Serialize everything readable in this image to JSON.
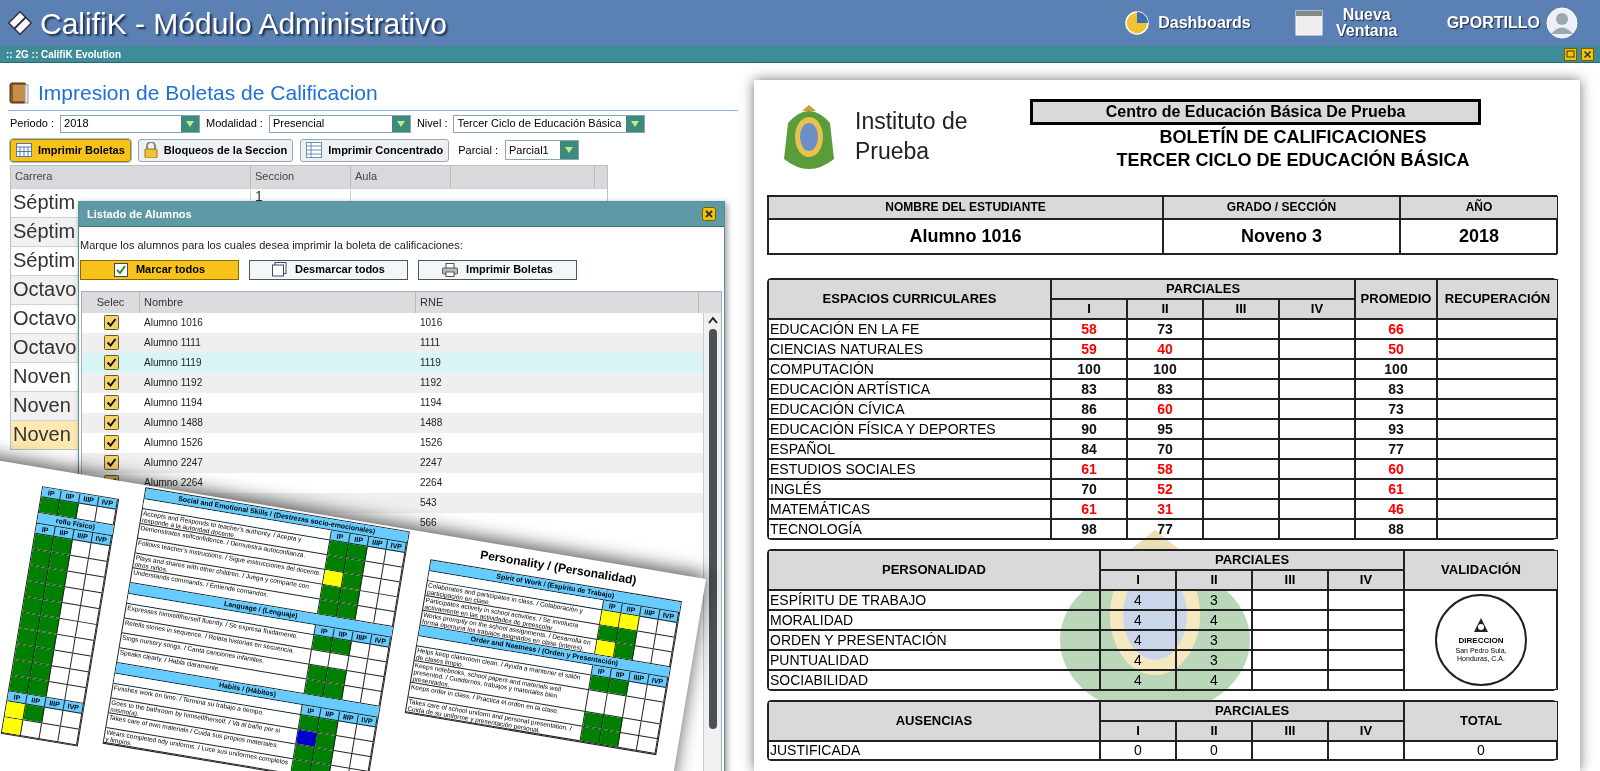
{
  "app_bar": {
    "title": "CalifiK - Módulo Administrativo",
    "links": [
      {
        "kind": "dashboards",
        "label": "Dashboards"
      },
      {
        "kind": "new-window",
        "label": "Nueva Ventana"
      }
    ],
    "user": "GPORTILLO"
  },
  "window_bar": {
    "title": ":: 2G :: CalifiK Evolution"
  },
  "panel": {
    "title": "Impresion de Boletas de Calificacion",
    "filters": [
      {
        "label": "Periodo :",
        "value": "2018"
      },
      {
        "label": "Modalidad :",
        "value": "Presencial"
      },
      {
        "label": "Nivel :",
        "value": "Tercer Ciclo de Educación Básica"
      }
    ],
    "buttons": [
      {
        "kind": "grid",
        "label": "Imprimir Boletas",
        "selected": true
      },
      {
        "kind": "lock",
        "label": "Bloqueos de la Seccion",
        "selected": false
      },
      {
        "kind": "table",
        "label": "Imprimir Concentrado",
        "selected": false
      }
    ],
    "parcial": {
      "label": "Parcial :",
      "value": "Parcial1"
    },
    "grid": {
      "columns": [
        "Carrera",
        "Seccion",
        "Aula"
      ],
      "rows": [
        {
          "carrera": "Séptim",
          "seccion": "1",
          "selected": false
        },
        {
          "carrera": "Séptim",
          "selected": false
        },
        {
          "carrera": "Séptim",
          "selected": false
        },
        {
          "carrera": "Octavo",
          "selected": false
        },
        {
          "carrera": "Octavo",
          "selected": false
        },
        {
          "carrera": "Octavo",
          "selected": false
        },
        {
          "carrera": "Noven",
          "selected": false
        },
        {
          "carrera": "Noven",
          "selected": false
        },
        {
          "carrera": "Noven",
          "selected": true
        }
      ]
    }
  },
  "dialog": {
    "title": "Listado de Alumnos",
    "instruction": "Marque los alumnos para los cuales desea imprimir la boleta de calificaciones:",
    "buttons": [
      {
        "kind": "check-all",
        "label": "Marcar todos",
        "selected": true
      },
      {
        "kind": "uncheck-all",
        "label": "Desmarcar todos",
        "selected": false
      },
      {
        "kind": "print",
        "label": "Imprimir Boletas",
        "selected": false
      }
    ],
    "columns": [
      "Selec",
      "Nombre",
      "RNE"
    ],
    "rows": [
      {
        "name": "Alumno 1016",
        "rne": "1016",
        "checked": true,
        "selected": false
      },
      {
        "name": "Alumno 1111",
        "rne": "1111",
        "checked": true,
        "selected": false
      },
      {
        "name": "Alumno 1119",
        "rne": "1119",
        "checked": true,
        "selected": true
      },
      {
        "name": "Alumno 1192",
        "rne": "1192",
        "checked": true,
        "selected": false
      },
      {
        "name": "Alumno 1194",
        "rne": "1194",
        "checked": true,
        "selected": false
      },
      {
        "name": "Alumno 1488",
        "rne": "1488",
        "checked": true,
        "selected": false
      },
      {
        "name": "Alumno 1526",
        "rne": "1526",
        "checked": true,
        "selected": false
      },
      {
        "name": "Alumno 2247",
        "rne": "2247",
        "checked": true,
        "selected": false
      },
      {
        "name": "Alumno 2264",
        "rne": "2264",
        "checked": true,
        "selected": false
      },
      {
        "rne": "543",
        "selected": false
      },
      {
        "rne": "566",
        "selected": false
      }
    ]
  },
  "report_preview": {
    "left_sections": [
      {
        "headers": [
          "IP",
          "IIP",
          "IIIP",
          "IVP"
        ],
        "rows": [
          {
            "marks": [
              {
                "color": "#008000"
              },
              {
                "color": "#008000"
              }
            ]
          }
        ]
      },
      {
        "title": "rollo Físico)",
        "headers": [
          "IP",
          "IIP",
          "IIIP",
          "IVP"
        ],
        "rows": [
          {
            "marks": [
              {
                "color": "#008000"
              },
              {
                "color": "#008000"
              }
            ]
          },
          {
            "marks": [
              {
                "color": "#008000"
              },
              {
                "color": "#008000"
              }
            ]
          },
          {
            "marks": [
              {
                "color": "#008000"
              },
              {
                "color": "#008000"
              }
            ]
          },
          {
            "marks": [
              {
                "color": "#008000"
              },
              {
                "color": "#008000"
              }
            ]
          },
          {
            "marks": [
              {
                "color": "#008000"
              },
              {
                "color": "#008000"
              }
            ]
          },
          {
            "marks": [
              {
                "color": "#008000"
              },
              {
                "color": "#008000"
              }
            ]
          },
          {
            "marks": [
              {
                "color": "#008000"
              },
              {
                "color": "#008000"
              }
            ]
          },
          {
            "marks": [
              {
                "color": "#008000"
              },
              {
                "color": "#008000"
              }
            ]
          },
          {
            "marks": [
              {
                "color": "#008000"
              },
              {
                "color": "#008000"
              }
            ]
          },
          {
            "marks": [
              {
                "color": "#008000"
              },
              {
                "color": "#008000"
              }
            ]
          }
        ]
      },
      {
        "headers": [
          "IP",
          "IIP",
          "IIIP",
          "IVP"
        ],
        "rows": [
          {
            "marks": [
              {
                "color": "#ffff00"
              },
              {
                "color": "#008000"
              }
            ]
          },
          {
            "marks": [
              {
                "color": "#ffff00"
              }
            ]
          }
        ]
      }
    ],
    "middle_sections": [
      {
        "title": "Social and Emotional Skills / (Destrezas socio-emocionales)",
        "headers": [
          "IP",
          "IIP",
          "IIIP",
          "IVP"
        ],
        "rows": [
          {
            "text": "Accepts and Responds to teacher's authority. / Acepta y responde a la autoridad docente.",
            "marks": [
              {
                "color": "#008000"
              },
              {
                "color": "#008000"
              }
            ]
          },
          {
            "text": "Demonstrates selfconfidence. / Demuestra autoconfianza.",
            "marks": [
              {
                "color": "#008000"
              },
              {
                "color": "#008000"
              }
            ]
          },
          {
            "text": "Follows teacher's instructions. / Sigue instrucciones del docente.",
            "marks": [
              {
                "color": "#ffff00"
              },
              {
                "color": "#008000"
              }
            ]
          },
          {
            "text": "Plays and shares with other children. / Juega y comparte con otros niños.",
            "marks": [
              {
                "color": "#008000"
              },
              {
                "color": "#008000"
              }
            ]
          },
          {
            "text": "Understands commands. / Entiende comandos.",
            "marks": [
              {
                "color": "#008000"
              },
              {
                "color": "#008000"
              }
            ]
          }
        ]
      },
      {
        "title": "Language / (Lenguaje)",
        "headers": [
          "IP",
          "IIP",
          "IIIP",
          "IVP"
        ],
        "rows": [
          {
            "text": "Expresses himself/herself fluently. / Se expresa fluidamente.",
            "marks": [
              {
                "color": "#008000"
              },
              {
                "color": "#008000"
              }
            ]
          },
          {
            "text": "Retells stories in sequence. / Relata historias en secuencia."
          },
          {
            "text": "Sings nursery songs. / Canta canciones infantiles.",
            "marks": [
              {
                "color": "#008000"
              },
              {
                "color": "#008000"
              }
            ]
          },
          {
            "text": "Speaks clearly. / Habla claramente.",
            "marks": [
              {
                "color": "#008000"
              },
              {
                "color": "#008000"
              }
            ]
          }
        ]
      },
      {
        "title": "Habits / (Hábitos)",
        "headers": [
          "IP",
          "IIP",
          "IIIP",
          "IVP"
        ],
        "rows": [
          {
            "text": "Finishes work on time. / Termina su trabajo a tiempo.",
            "marks": [
              {
                "color": "#008000"
              },
              {
                "color": "#008000"
              }
            ]
          },
          {
            "text": "Goes to the bathroom by himself/herself. / Va al baño por si mismo(a).",
            "marks": [
              {
                "color": "#0000cc"
              },
              {
                "color": "#008000"
              }
            ]
          },
          {
            "text": "Takes care of own materials / Cuida sus propios materiales.",
            "marks": [
              {
                "color": "#008000"
              },
              {
                "color": "#008000"
              }
            ]
          },
          {
            "text": "Wears completed tidy uniforms. / Luce sus uniformes completos y limpios.",
            "marks": [
              {
                "color": "#008000"
              },
              {
                "color": "#008000"
              }
            ]
          }
        ]
      }
    ],
    "right_title": "Personality / (Personalidad)",
    "right_sections": [
      {
        "title": "Spirit of Work / (Espíritu de Trabajo)",
        "headers": [
          "IP",
          "IIP",
          "IIIP",
          "IVP"
        ],
        "rows": [
          {
            "text": "Colaborates and participates in class. / Colaboración y participación en clase.",
            "marks": [
              {
                "color": "#ffff00"
              },
              {
                "color": "#ffff00"
              }
            ]
          },
          {
            "text": "Participates actively in school activities. / Se involucra activamente en las actividades de preescolar .",
            "marks": [
              {
                "color": "#008000"
              },
              {
                "color": "#008000"
              }
            ]
          },
          {
            "text": "Works promptly on the school assignments. / Desarrolla en forma oportuna los trabajos asignados en clase (interés).",
            "marks": [
              {
                "color": "#ffff00"
              },
              {
                "color": "#008000"
              }
            ]
          }
        ]
      },
      {
        "title": "Order and Neatness / (Orden y Presentación)",
        "headers": [
          "IP",
          "IIP",
          "IIIP",
          "IVP"
        ],
        "rows": [
          {
            "text": "Helps keep classroom clean. / Ayuda a mantener el salón de clases limpio.",
            "marks": [
              {
                "color": "#008000"
              },
              {
                "color": "#008000"
              }
            ]
          },
          {
            "text": "Keeps notebooks, school papers and materials well presented. / Cuadernos, trabajos y materiales bien presentados."
          },
          {
            "text": "Keeps order in class. / Practica el orden en la clase.",
            "marks": [
              {
                "color": "#008000"
              },
              {
                "color": "#008000"
              }
            ]
          },
          {
            "text": "Takes care of school uniform and personal presentation. / Cuida de su uniforme y presentación personal.",
            "marks": [
              {
                "color": "#008000"
              },
              {
                "color": "#008000"
              }
            ]
          }
        ]
      }
    ]
  },
  "report_card": {
    "institution": "Instituto de Prueba",
    "school": "Centro de Educación Básica De Prueba",
    "titles": [
      "BOLETÍN DE CALIFICACIONES",
      "TERCER CICLO DE EDUCACIÓN BÁSICA"
    ],
    "student": {
      "columns": [
        "NOMBRE DEL ESTUDIANTE",
        "GRADO / SECCIÓN",
        "AÑO"
      ],
      "values": [
        "Alumno 1016",
        "Noveno 3",
        "2018"
      ]
    },
    "subjects": {
      "header": "ESPACIOS CURRICULARES",
      "group": "PARCIALES",
      "parciales": [
        "I",
        "II",
        "III",
        "IV"
      ],
      "average": "PROMEDIO",
      "recovery": "RECUPERACIÓN",
      "rows": [
        {
          "name": "EDUCACIÓN EN LA FE",
          "grades": [
            {
              "value": "58",
              "low": true
            },
            {
              "value": "73",
              "low": false
            }
          ],
          "average": {
            "value": "66",
            "low": true
          }
        },
        {
          "name": "CIENCIAS NATURALES",
          "grades": [
            {
              "value": "59",
              "low": true
            },
            {
              "value": "40",
              "low": true
            }
          ],
          "average": {
            "value": "50",
            "low": true
          }
        },
        {
          "name": "COMPUTACIÓN",
          "grades": [
            {
              "value": "100",
              "low": false
            },
            {
              "value": "100",
              "low": false
            }
          ],
          "average": {
            "value": "100",
            "low": false
          }
        },
        {
          "name": "EDUCACIÓN ARTÍSTICA",
          "grades": [
            {
              "value": "83",
              "low": false
            },
            {
              "value": "83",
              "low": false
            }
          ],
          "average": {
            "value": "83",
            "low": false
          }
        },
        {
          "name": "EDUCACIÓN CÍVICA",
          "grades": [
            {
              "value": "86",
              "low": false
            },
            {
              "value": "60",
              "low": true
            }
          ],
          "average": {
            "value": "73",
            "low": false
          }
        },
        {
          "name": "EDUCACIÓN FÍSICA Y DEPORTES",
          "grades": [
            {
              "value": "90",
              "low": false
            },
            {
              "value": "95",
              "low": false
            }
          ],
          "average": {
            "value": "93",
            "low": false
          }
        },
        {
          "name": "ESPAÑOL",
          "grades": [
            {
              "value": "84",
              "low": false
            },
            {
              "value": "70",
              "low": false
            }
          ],
          "average": {
            "value": "77",
            "low": false
          }
        },
        {
          "name": "ESTUDIOS SOCIALES",
          "grades": [
            {
              "value": "61",
              "low": true
            },
            {
              "value": "58",
              "low": true
            }
          ],
          "average": {
            "value": "60",
            "low": true
          }
        },
        {
          "name": "INGLÉS",
          "grades": [
            {
              "value": "70",
              "low": false
            },
            {
              "value": "52",
              "low": true
            }
          ],
          "average": {
            "value": "61",
            "low": true
          }
        },
        {
          "name": "MATEMÁTICAS",
          "grades": [
            {
              "value": "61",
              "low": true
            },
            {
              "value": "31",
              "low": true
            }
          ],
          "average": {
            "value": "46",
            "low": true
          }
        },
        {
          "name": "TECNOLOGÍA",
          "grades": [
            {
              "value": "98",
              "low": false
            },
            {
              "value": "77",
              "low": false
            }
          ],
          "average": {
            "value": "88",
            "low": false
          }
        }
      ]
    },
    "personality": {
      "header": "PERSONALIDAD",
      "group": "PARCIALES",
      "parciales": [
        "I",
        "II",
        "III",
        "IV"
      ],
      "validation": "VALIDACIÓN",
      "rows": [
        {
          "name": "ESPÍRITU DE TRABAJO",
          "grades": [
            "4",
            "3"
          ]
        },
        {
          "name": "MORALIDAD",
          "grades": [
            "4",
            "4"
          ]
        },
        {
          "name": "ORDEN Y PRESENTACIÓN",
          "grades": [
            "4",
            "3"
          ]
        },
        {
          "name": "PUNTUALIDAD",
          "grades": [
            "4",
            "3"
          ]
        },
        {
          "name": "SOCIABILIDAD",
          "grades": [
            "4",
            "4"
          ]
        }
      ],
      "stamp": {
        "title": "DIRECCION",
        "place": "San Pedro Sula, Honduras, C.A."
      }
    },
    "absences": {
      "header": "AUSENCIAS",
      "group": "PARCIALES",
      "parciales": [
        "I",
        "II",
        "III",
        "IV"
      ],
      "total_header": "TOTAL",
      "rows": [
        {
          "name": "JUSTIFICADA",
          "grades": [
            "0",
            "0"
          ],
          "total": "0"
        }
      ]
    }
  }
}
